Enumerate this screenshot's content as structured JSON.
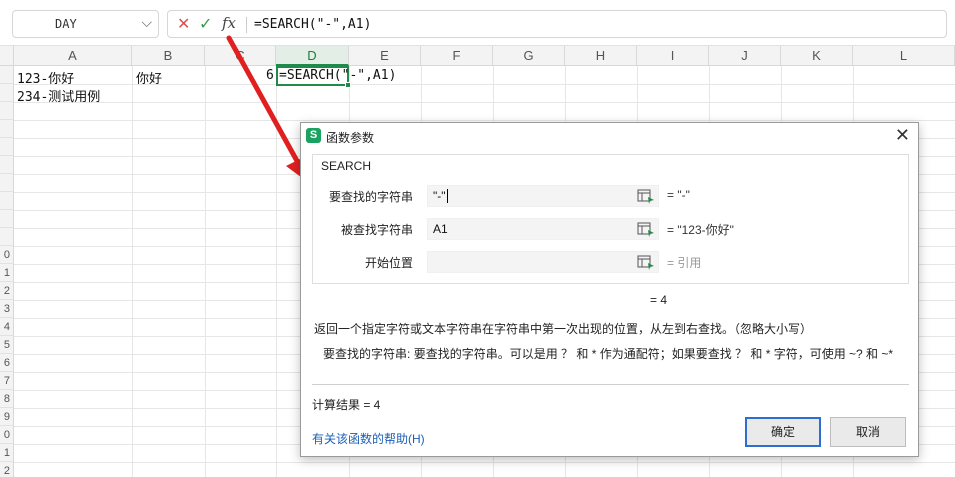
{
  "formula_bar": {
    "name_box": "DAY",
    "name_box_arrow": "⌵",
    "cancel_glyph": "✕",
    "confirm_glyph": "✓",
    "fx_label": "fx",
    "formula": "=SEARCH(\"-\",A1)"
  },
  "grid": {
    "columns": [
      "A",
      "B",
      "C",
      "D",
      "E",
      "F",
      "G",
      "H",
      "I",
      "J",
      "K",
      "L"
    ],
    "active_column": "D",
    "row_numbers": [
      "",
      "",
      "",
      "",
      "",
      "",
      "",
      "",
      "",
      "",
      "0",
      "1",
      "2",
      "3",
      "4",
      "5",
      "6",
      "7",
      "8",
      "9",
      "0",
      "1",
      "2",
      "3"
    ],
    "cells": {
      "a1": "123-你好",
      "b1": "你好",
      "c1": "6",
      "d1": "=SEARCH(\"-\",A1)",
      "a2": "234-测试用例"
    }
  },
  "dialog": {
    "title": "函数参数",
    "logo": "S",
    "close_glyph": "✕",
    "function_name": "SEARCH",
    "args": [
      {
        "label": "要查找的字符串",
        "value": "\"-\"",
        "result": "= \"-\""
      },
      {
        "label": "被查找字符串",
        "value": "A1",
        "result": "= \"123-你好\""
      },
      {
        "label": "开始位置",
        "value": "",
        "result": "= 引用"
      }
    ],
    "formula_result": "= 4",
    "description": "返回一个指定字符或文本字符串在字符串中第一次出现的位置，从左到右查找。（忽略大小写）",
    "arg_description_label": "要查找的字符串:",
    "arg_description": "要查找的字符串。可以是用 ？ 和 * 作为通配符；如果要查找 ？ 和 * 字符，可使用 ~? 和 ~*",
    "calc_result": "计算结果 = 4",
    "help_link": "有关该函数的帮助(H)",
    "ok_button": "确定",
    "cancel_button": "取消"
  },
  "colors": {
    "accent_green": "#1f8a4a",
    "annotation_arrow": "#e02020",
    "link_blue": "#1a5fb4",
    "primary_button_border": "#2c6fd1"
  }
}
